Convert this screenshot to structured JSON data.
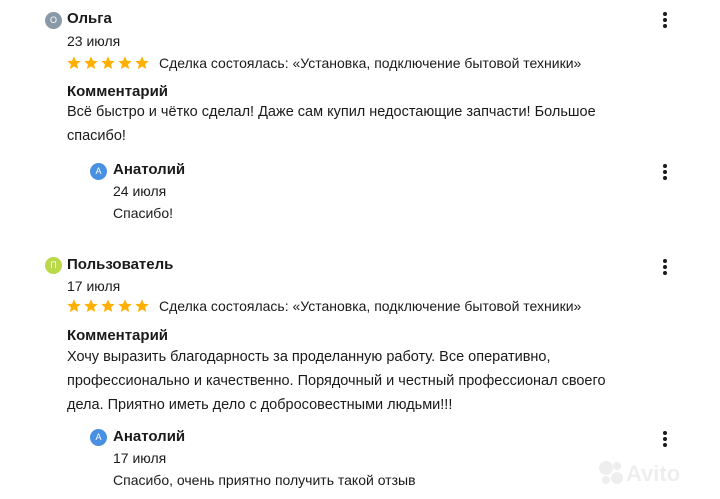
{
  "reviews": [
    {
      "author": {
        "initial": "О",
        "name": "Ольга",
        "avatar_color": "#8a99a6"
      },
      "date": "23 июля",
      "rating": 5,
      "deal": "Сделка состоялась: «Установка, подключение бытовой техники»",
      "comment_title": "Комментарий",
      "comment_lines": [
        "Всё быстро и чётко сделал! Даже сам купил недостающие запчасти! Большое",
        "спасибо!"
      ],
      "reply": {
        "initial": "А",
        "name": "Анатолий",
        "avatar_color": "#4a90e2",
        "date": "24 июля",
        "text": "Спасибо!"
      }
    },
    {
      "author": {
        "initial": "П",
        "name": "Пользователь",
        "avatar_color": "#b9d84a"
      },
      "date": "17 июля",
      "rating": 5,
      "deal": "Сделка состоялась: «Установка, подключение бытовой техники»",
      "comment_title": "Комментарий",
      "comment_lines": [
        "Хочу выразить благодарность за проделанную работу. Все оперативно,",
        "профессионально и качественно. Порядочный и честный профессионал своего",
        "дела. Приятно иметь дело с добросовестными людьми!!!"
      ],
      "reply": {
        "initial": "А",
        "name": "Анатолий",
        "avatar_color": "#4a90e2",
        "date": "17 июля",
        "text": "Спасибо, очень приятно получить такой отзыв"
      }
    }
  ],
  "colors": {
    "star": "#ffb000",
    "text": "#1a1a1a"
  },
  "watermark": {
    "text": "Avito"
  }
}
